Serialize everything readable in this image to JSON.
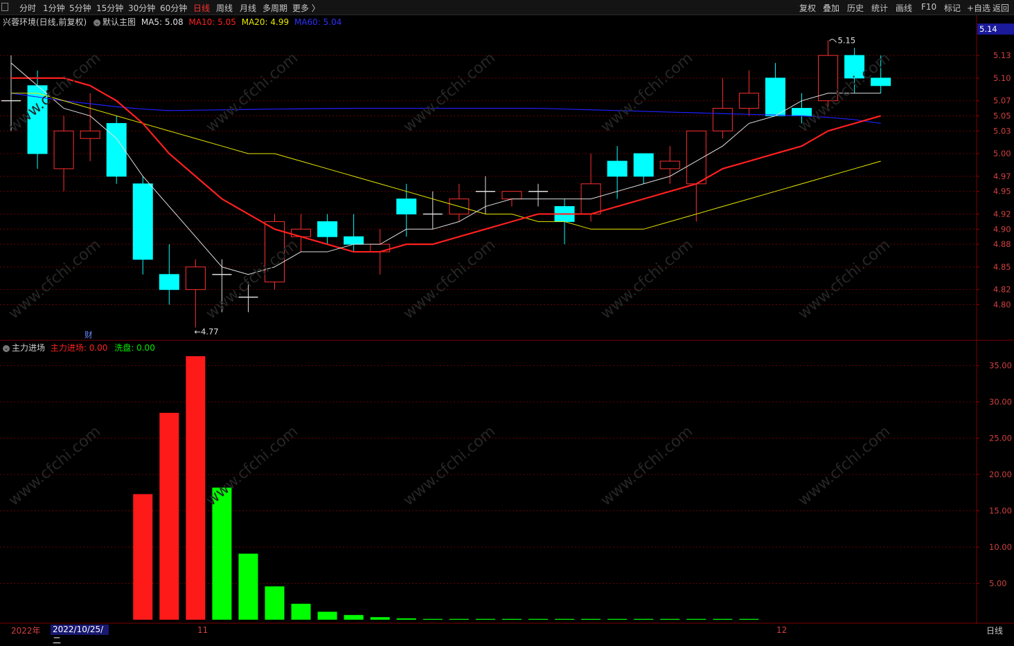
{
  "toolbar": {
    "periods": [
      "分时",
      "1分钟",
      "5分钟",
      "15分钟",
      "30分钟",
      "60分钟",
      "日线",
      "周线",
      "月线",
      "多周期",
      "更多 〉"
    ],
    "active_period": "日线",
    "actions": [
      "复权",
      "叠加",
      "历史",
      "统计",
      "画线",
      "F10",
      "标记",
      "+自选",
      "返回"
    ]
  },
  "main_legend": {
    "stock": "兴蓉环境(日线,前复权)",
    "template": "默认主图",
    "ma": [
      {
        "label": "MA5: 5.08",
        "color": "#e0e0e0"
      },
      {
        "label": "MA10: 5.05",
        "color": "#ff2020"
      },
      {
        "label": "MA20: 4.99",
        "color": "#e8e800"
      },
      {
        "label": "MA60: 5.04",
        "color": "#2020ff"
      }
    ]
  },
  "sub_legend": {
    "name": "主力进场",
    "items": [
      {
        "label": "主力进场: 0.00",
        "color": "#ff2020"
      },
      {
        "label": "洗盘: 0.00",
        "color": "#00ff00"
      }
    ]
  },
  "annotations": {
    "high": "5.15",
    "low": "←4.77",
    "cai": "财",
    "current_price": "5.14"
  },
  "bottom": {
    "year": "2022年",
    "cursor_date": "2022/10/25/二",
    "month_11": "11",
    "month_12": "12",
    "period": "日线"
  },
  "colors": {
    "up": "#ff3030",
    "down": "#00ffff",
    "ma5": "#e0e0e0",
    "ma10": "#ff2020",
    "ma20": "#e8e800",
    "ma60": "#2020ff",
    "grid": "#6a0000",
    "axis_text": "#d04040"
  },
  "chart_data": [
    {
      "type": "candlestick",
      "title": "兴蓉环境(日线,前复权)",
      "y_ticks": [
        5.13,
        5.1,
        5.07,
        5.05,
        5.03,
        5.0,
        4.97,
        4.95,
        4.92,
        4.9,
        4.88,
        4.85,
        4.82,
        4.8
      ],
      "ylim": [
        4.785,
        5.165
      ],
      "candles": [
        {
          "o": 5.07,
          "h": 5.13,
          "l": 5.03,
          "c": 5.07
        },
        {
          "o": 5.09,
          "h": 5.11,
          "l": 4.98,
          "c": 5.0
        },
        {
          "o": 4.98,
          "h": 5.05,
          "l": 4.95,
          "c": 5.03
        },
        {
          "o": 5.02,
          "h": 5.08,
          "l": 4.99,
          "c": 5.03
        },
        {
          "o": 5.04,
          "h": 5.05,
          "l": 4.96,
          "c": 4.97
        },
        {
          "o": 4.96,
          "h": 4.97,
          "l": 4.84,
          "c": 4.86
        },
        {
          "o": 4.84,
          "h": 4.88,
          "l": 4.8,
          "c": 4.82
        },
        {
          "o": 4.82,
          "h": 4.86,
          "l": 4.77,
          "c": 4.85
        },
        {
          "o": 4.84,
          "h": 4.86,
          "l": 4.79,
          "c": 4.84
        },
        {
          "o": 4.81,
          "h": 4.83,
          "l": 4.79,
          "c": 4.81
        },
        {
          "o": 4.83,
          "h": 4.92,
          "l": 4.82,
          "c": 4.91
        },
        {
          "o": 4.89,
          "h": 4.92,
          "l": 4.87,
          "c": 4.9
        },
        {
          "o": 4.91,
          "h": 4.92,
          "l": 4.88,
          "c": 4.89
        },
        {
          "o": 4.89,
          "h": 4.92,
          "l": 4.87,
          "c": 4.88
        },
        {
          "o": 4.87,
          "h": 4.9,
          "l": 4.84,
          "c": 4.88
        },
        {
          "o": 4.94,
          "h": 4.96,
          "l": 4.89,
          "c": 4.92
        },
        {
          "o": 4.92,
          "h": 4.95,
          "l": 4.9,
          "c": 4.92
        },
        {
          "o": 4.92,
          "h": 4.96,
          "l": 4.91,
          "c": 4.94
        },
        {
          "o": 4.95,
          "h": 4.97,
          "l": 4.92,
          "c": 4.95
        },
        {
          "o": 4.94,
          "h": 4.95,
          "l": 4.93,
          "c": 4.95
        },
        {
          "o": 4.95,
          "h": 4.96,
          "l": 4.93,
          "c": 4.95
        },
        {
          "o": 4.93,
          "h": 4.94,
          "l": 4.88,
          "c": 4.91
        },
        {
          "o": 4.92,
          "h": 5.0,
          "l": 4.91,
          "c": 4.96
        },
        {
          "o": 4.99,
          "h": 5.01,
          "l": 4.94,
          "c": 4.97
        },
        {
          "o": 5.0,
          "h": 5.0,
          "l": 4.96,
          "c": 4.97
        },
        {
          "o": 4.98,
          "h": 5.01,
          "l": 4.96,
          "c": 4.99
        },
        {
          "o": 4.96,
          "h": 5.03,
          "l": 4.91,
          "c": 5.03
        },
        {
          "o": 5.03,
          "h": 5.1,
          "l": 5.02,
          "c": 5.06
        },
        {
          "o": 5.06,
          "h": 5.11,
          "l": 5.05,
          "c": 5.08
        },
        {
          "o": 5.1,
          "h": 5.12,
          "l": 5.05,
          "c": 5.05
        },
        {
          "o": 5.06,
          "h": 5.08,
          "l": 5.04,
          "c": 5.05
        },
        {
          "o": 5.07,
          "h": 5.15,
          "l": 5.06,
          "c": 5.13
        },
        {
          "o": 5.13,
          "h": 5.14,
          "l": 5.08,
          "c": 5.1
        },
        {
          "o": 5.1,
          "h": 5.13,
          "l": 5.08,
          "c": 5.09
        }
      ],
      "ma5": [
        5.12,
        5.09,
        5.06,
        5.05,
        5.02,
        4.97,
        4.93,
        4.89,
        4.85,
        4.84,
        4.85,
        4.87,
        4.87,
        4.88,
        4.88,
        4.9,
        4.9,
        4.91,
        4.93,
        4.94,
        4.94,
        4.94,
        4.94,
        4.95,
        4.96,
        4.97,
        4.99,
        5.01,
        5.04,
        5.05,
        5.07,
        5.08,
        5.08,
        5.08
      ],
      "ma10": [
        5.1,
        5.1,
        5.1,
        5.09,
        5.07,
        5.04,
        5.0,
        4.97,
        4.94,
        4.92,
        4.9,
        4.89,
        4.88,
        4.87,
        4.87,
        4.88,
        4.88,
        4.89,
        4.9,
        4.91,
        4.92,
        4.92,
        4.92,
        4.93,
        4.94,
        4.95,
        4.96,
        4.98,
        4.99,
        5.0,
        5.01,
        5.03,
        5.04,
        5.05
      ],
      "ma20": [
        5.08,
        5.08,
        5.07,
        5.06,
        5.05,
        5.04,
        5.03,
        5.02,
        5.01,
        5.0,
        5.0,
        4.99,
        4.98,
        4.97,
        4.96,
        4.95,
        4.94,
        4.93,
        4.92,
        4.92,
        4.91,
        4.91,
        4.9,
        4.9,
        4.9,
        4.91,
        4.92,
        4.93,
        4.94,
        4.95,
        4.96,
        4.97,
        4.98,
        4.99
      ],
      "ma60": [
        5.08,
        5.075,
        5.07,
        5.066,
        5.062,
        5.059,
        5.057,
        5.0575,
        5.058,
        5.0585,
        5.059,
        5.0593,
        5.0597,
        5.06,
        5.06,
        5.06,
        5.06,
        5.06,
        5.06,
        5.06,
        5.06,
        5.059,
        5.058,
        5.057,
        5.056,
        5.055,
        5.054,
        5.053,
        5.052,
        5.051,
        5.05,
        5.048,
        5.045,
        5.04
      ]
    },
    {
      "type": "bar",
      "title": "主力进场",
      "y_ticks": [
        35.0,
        30.0,
        25.0,
        20.0,
        15.0,
        10.0,
        5.0
      ],
      "ylim": [
        0,
        36.5
      ],
      "series": [
        {
          "name": "主力进场",
          "values": [
            0,
            0,
            0,
            0,
            0,
            17.3,
            28.5,
            36.3,
            0,
            0,
            0,
            0,
            0,
            0,
            0,
            0,
            0,
            0,
            0,
            0,
            0,
            0,
            0,
            0,
            0,
            0,
            0,
            0,
            0,
            0,
            0,
            0,
            0,
            0
          ]
        },
        {
          "name": "洗盘",
          "values": [
            0,
            0,
            0,
            0,
            0,
            0,
            0,
            0,
            18.2,
            9.1,
            4.6,
            2.2,
            1.1,
            0.65,
            0.35,
            0.18,
            0.1,
            0.05,
            0.05,
            0.05,
            0.05,
            0.05,
            0.05,
            0.05,
            0.05,
            0.05,
            0.05,
            0.05,
            0.05,
            0,
            0,
            0,
            0,
            0
          ]
        }
      ]
    }
  ]
}
